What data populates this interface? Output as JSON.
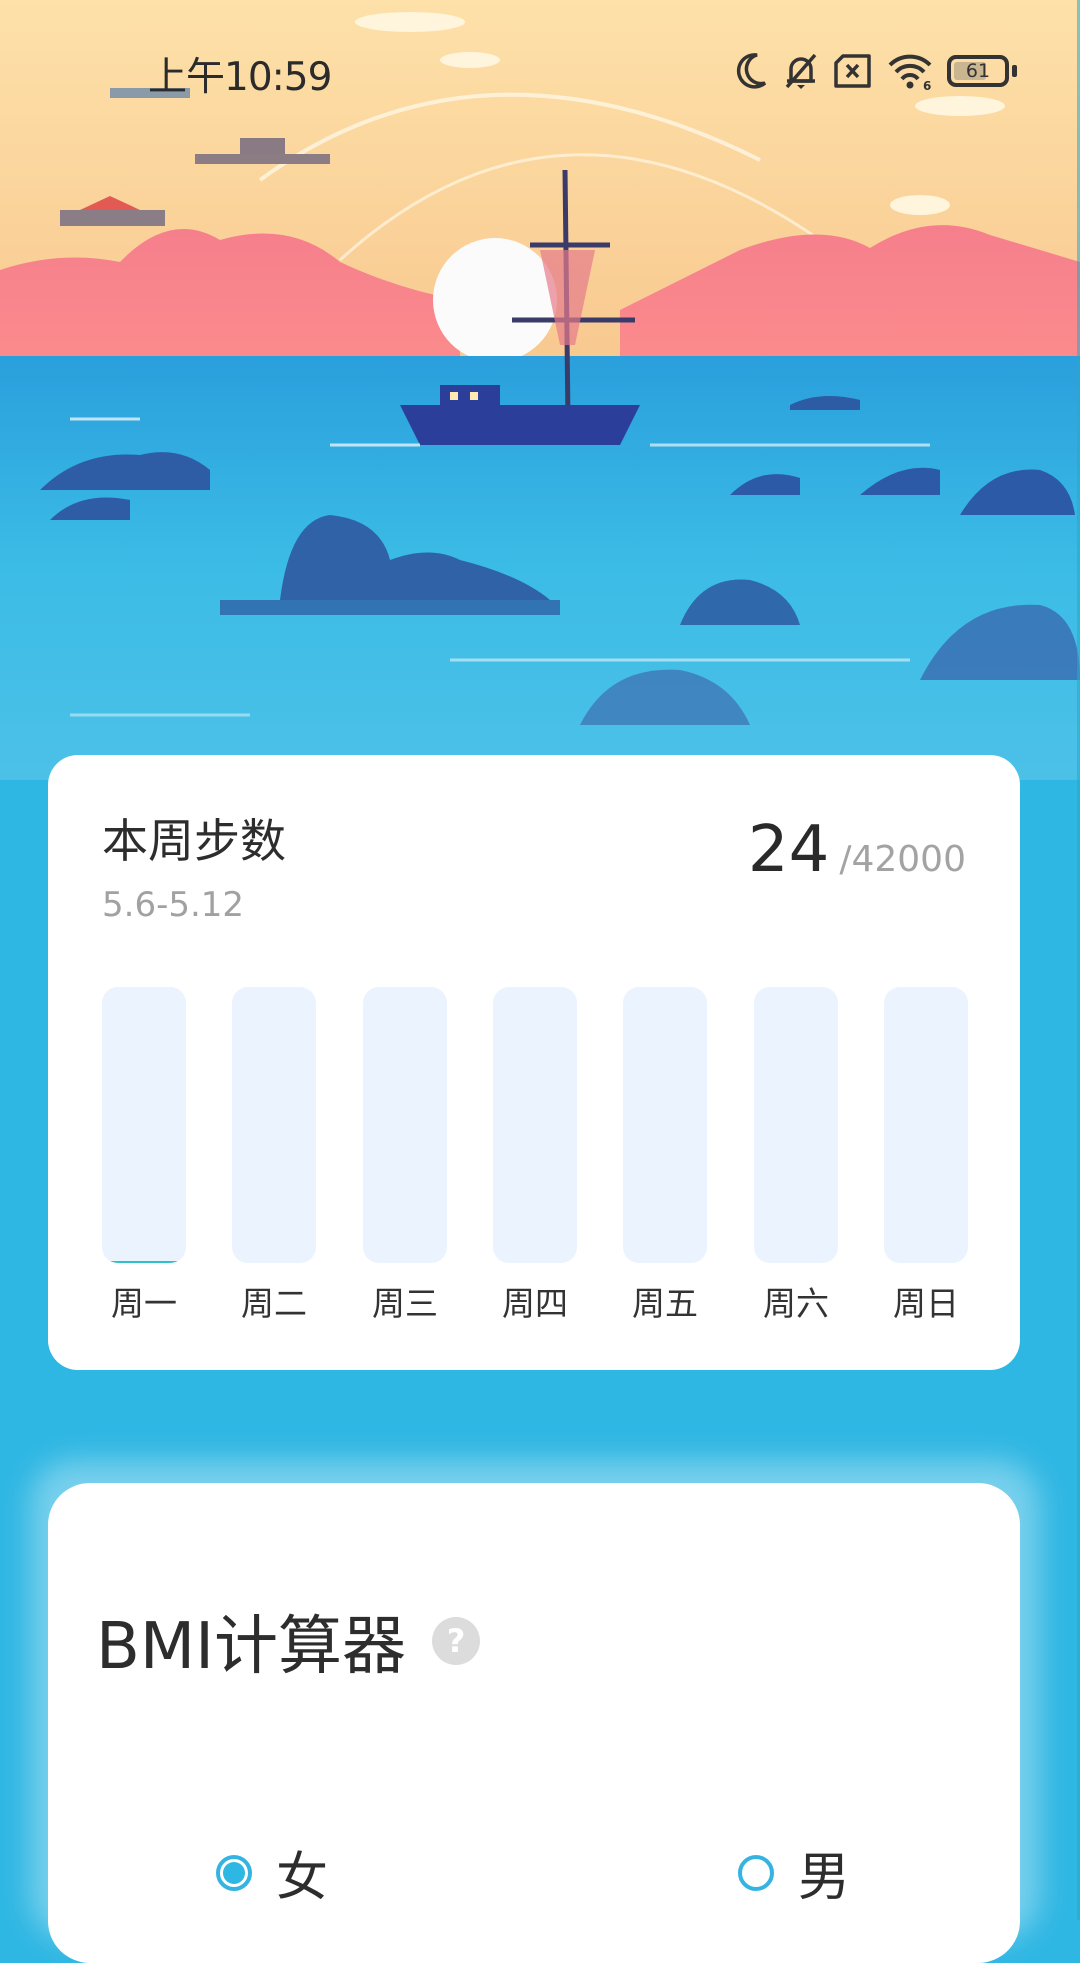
{
  "status_bar": {
    "time": "上午10:59",
    "icons": [
      "moon-icon",
      "bell-off-icon",
      "sim-off-icon",
      "wifi-icon"
    ],
    "battery_level": "61"
  },
  "steps_card": {
    "title": "本周步数",
    "date_range": "5.6-5.12",
    "current_steps": "24",
    "goal": "/42000"
  },
  "chart_data": {
    "type": "bar",
    "title": "本周步数",
    "categories": [
      "周一",
      "周二",
      "周三",
      "周四",
      "周五",
      "周六",
      "周日"
    ],
    "values": [
      24,
      0,
      0,
      0,
      0,
      0,
      0
    ],
    "ylim": [
      0,
      6000
    ],
    "xlabel": "",
    "ylabel": "",
    "colors": {
      "track": "#ebf3fe",
      "fill": "#2fc0c9"
    }
  },
  "bmi_card": {
    "title": "BMI计算器",
    "help_icon": "help-circle-icon",
    "gender_options": [
      {
        "label": "女",
        "selected": true
      },
      {
        "label": "男",
        "selected": false
      }
    ]
  },
  "colors": {
    "background": "#2fb7e3",
    "accent": "#2fb7e3",
    "text_primary": "#2d2d2d",
    "text_secondary": "#a1a1a1"
  }
}
